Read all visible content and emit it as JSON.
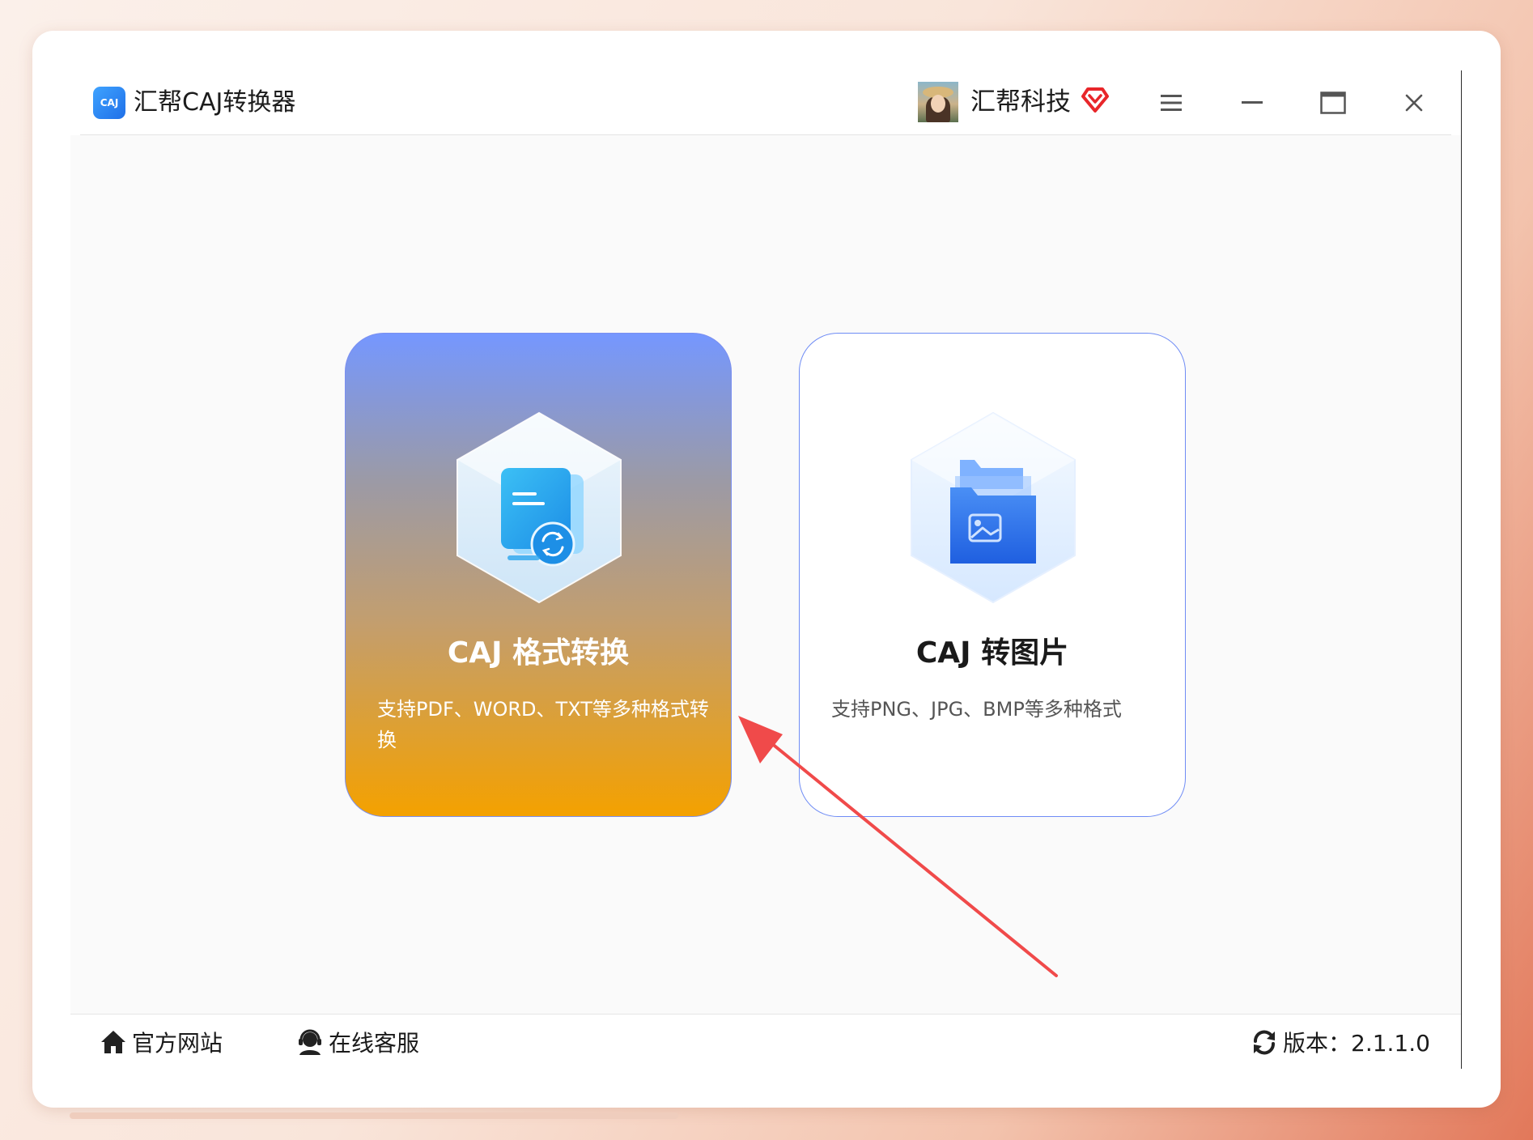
{
  "app": {
    "title": "汇帮CAJ转换器",
    "logo_text": "CAJ"
  },
  "header": {
    "user_name": "汇帮科技"
  },
  "cards": [
    {
      "title": "CAJ 格式转换",
      "description": "支持PDF、WORD、TXT等多种格式转换"
    },
    {
      "title": "CAJ 转图片",
      "description": "支持PNG、JPG、BMP等多种格式"
    }
  ],
  "footer": {
    "website_label": "官方网站",
    "support_label": "在线客服",
    "version_label": "版本：2.1.1.0"
  },
  "colors": {
    "accent_blue": "#6f8cf5",
    "orange": "#f4a100",
    "annotation_arrow": "#f04a4a",
    "vip_red": "#e8262a"
  },
  "icons": {
    "logo": "caj-logo-icon",
    "vip": "vip-diamond-icon",
    "menu": "hamburger-menu-icon",
    "minimize": "minimize-icon",
    "maximize": "maximize-icon",
    "close": "close-icon",
    "website": "home-icon",
    "support": "customer-service-icon",
    "version": "refresh-icon"
  }
}
